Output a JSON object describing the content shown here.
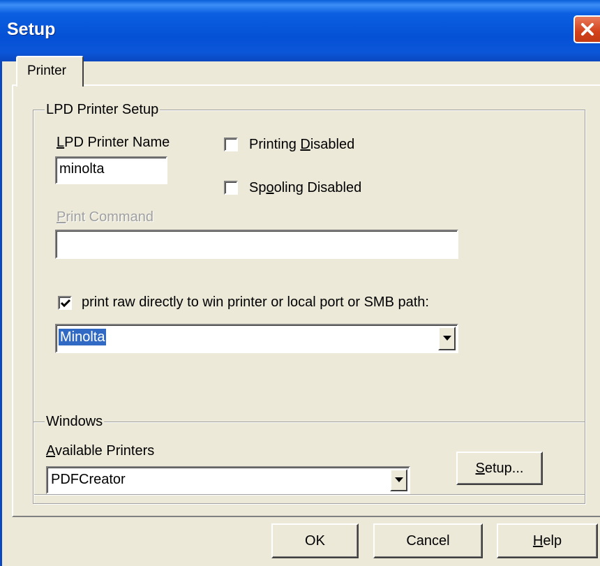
{
  "window": {
    "title": "Setup",
    "close_icon": "close-icon",
    "accent": "#0b5fe0",
    "close_color": "#d2411a"
  },
  "tabs": [
    {
      "label": "Printer",
      "selected": true
    }
  ],
  "lpd_group": {
    "title": "LPD Printer Setup",
    "printer_name_label": "LPD Printer Name",
    "printer_name_value": "minolta",
    "printing_disabled": {
      "label": "Printing Disabled",
      "checked": false
    },
    "spooling_disabled": {
      "label": "Spooling Disabled",
      "checked": false
    },
    "print_command_label": "Print Command",
    "print_command_value": "",
    "print_raw": {
      "label": "print raw directly to win printer or local port or SMB path:",
      "checked": true
    },
    "raw_target_value": "Minolta"
  },
  "windows_group": {
    "title": "Windows",
    "available_printers_label": "Available Printers",
    "available_printers_value": "PDFCreator",
    "setup_button": "Setup..."
  },
  "footer": {
    "ok": "OK",
    "cancel": "Cancel",
    "help": "Help"
  }
}
